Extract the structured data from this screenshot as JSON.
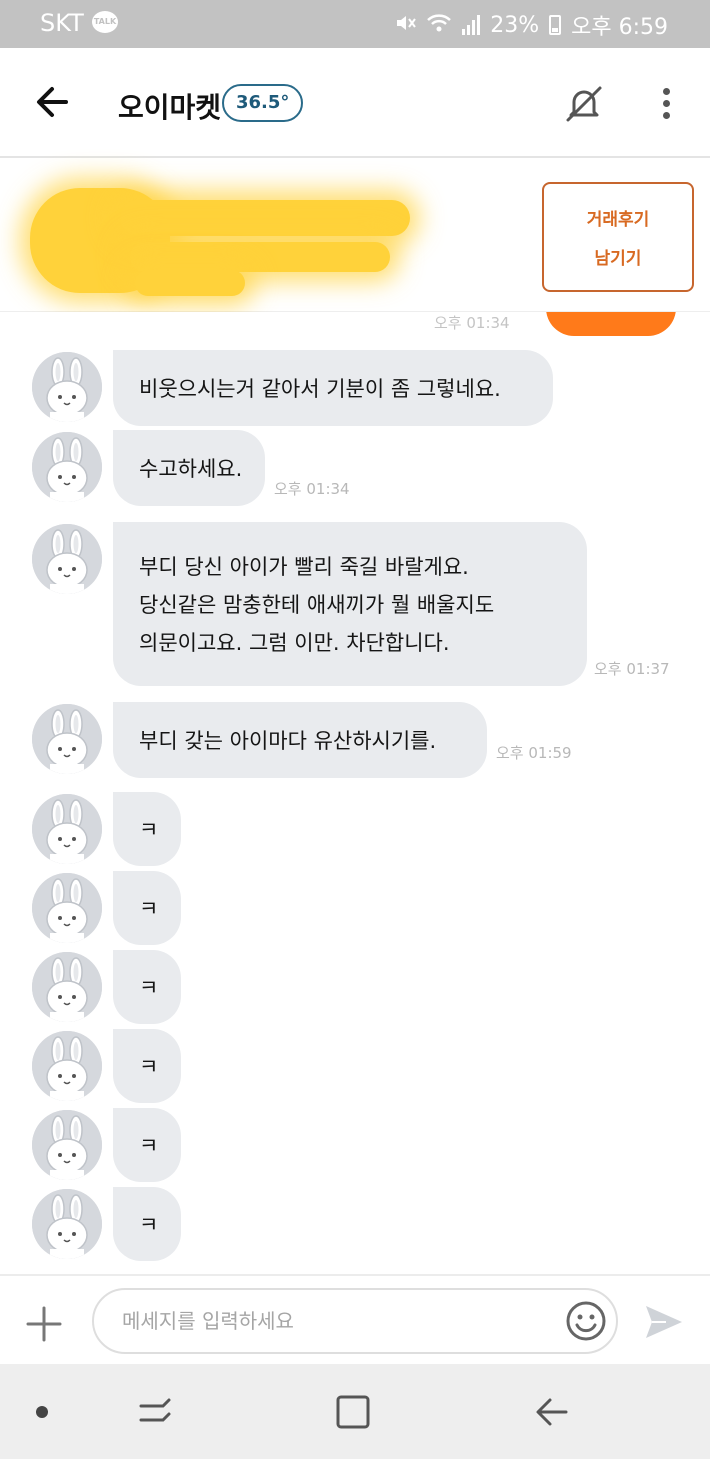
{
  "status_bar": {
    "carrier": "SKT",
    "talk_badge": "TALK",
    "battery": "23%",
    "time": "오후 6:59"
  },
  "header": {
    "title": "오이마켓",
    "temperature": "36.5°"
  },
  "banner": {
    "review_line1": "거래후기",
    "review_line2": "남기기"
  },
  "chat": {
    "previous_time": "오후 01:34",
    "messages": [
      {
        "lines": [
          "비웃으시는거  같아서 기분이 좀 그렇네요."
        ],
        "time": ""
      },
      {
        "lines": [
          "수고하세요."
        ],
        "time": "오후 01:34"
      },
      {
        "lines": [
          "부디 당신 아이가 빨리 죽길 바랄게요.",
          "당신같은 맘충한테 애새끼가 뭘 배울지도",
          "의문이고요. 그럼 이만. 차단합니다."
        ],
        "time": "오후 01:37"
      },
      {
        "lines": [
          "부디 갖는 아이마다 유산하시기를."
        ],
        "time": "오후 01:59"
      },
      {
        "lines": [
          "ㅋ"
        ],
        "time": ""
      },
      {
        "lines": [
          "ㅋ"
        ],
        "time": ""
      },
      {
        "lines": [
          "ㅋ"
        ],
        "time": ""
      },
      {
        "lines": [
          "ㅋ"
        ],
        "time": ""
      },
      {
        "lines": [
          "ㅋ"
        ],
        "time": ""
      },
      {
        "lines": [
          "ㅋ"
        ],
        "time": ""
      }
    ]
  },
  "input": {
    "placeholder": "메세지를 입력하세요"
  },
  "icons": {
    "back": "arrow-left-icon",
    "mute": "bell-off-icon",
    "more": "more-vertical-icon",
    "plus": "plus-icon",
    "emoji": "smiley-icon",
    "send": "send-icon"
  },
  "colors": {
    "accent_orange": "#ff7a1a",
    "review_text": "#d86a22",
    "temperature_border": "#2a6b8a",
    "bubble_bg": "#e9ebee"
  }
}
